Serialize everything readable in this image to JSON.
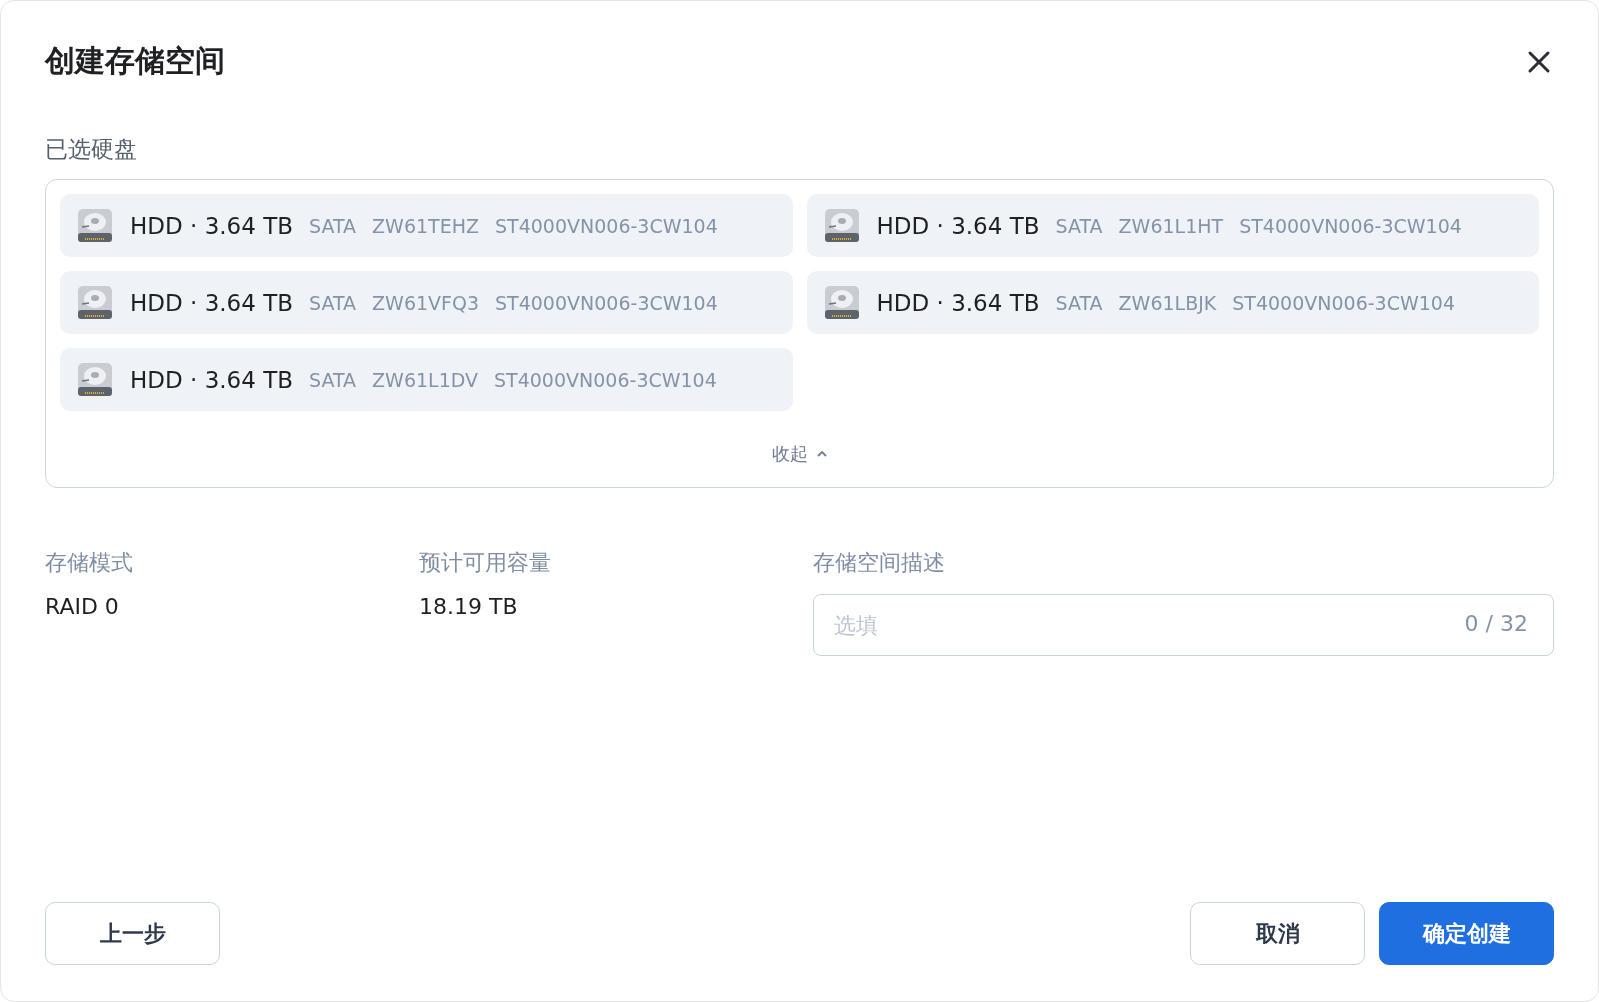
{
  "dialog": {
    "title": "创建存储空间"
  },
  "selected_disks": {
    "label": "已选硬盘",
    "collapse_link": "收起",
    "disks": [
      {
        "summary": "HDD · 3.64 TB",
        "interface": "SATA",
        "serial": "ZW61TEHZ",
        "model": "ST4000VN006-3CW104"
      },
      {
        "summary": "HDD · 3.64 TB",
        "interface": "SATA",
        "serial": "ZW61L1HT",
        "model": "ST4000VN006-3CW104"
      },
      {
        "summary": "HDD · 3.64 TB",
        "interface": "SATA",
        "serial": "ZW61VFQ3",
        "model": "ST4000VN006-3CW104"
      },
      {
        "summary": "HDD · 3.64 TB",
        "interface": "SATA",
        "serial": "ZW61LBJK",
        "model": "ST4000VN006-3CW104"
      },
      {
        "summary": "HDD · 3.64 TB",
        "interface": "SATA",
        "serial": "ZW61L1DV",
        "model": "ST4000VN006-3CW104"
      }
    ]
  },
  "storage_mode": {
    "label": "存储模式",
    "value": "RAID 0"
  },
  "capacity": {
    "label": "预计可用容量",
    "value": "18.19 TB"
  },
  "description": {
    "label": "存储空间描述",
    "placeholder": "选填",
    "counter": "0 / 32"
  },
  "buttons": {
    "back": "上一步",
    "cancel": "取消",
    "confirm": "确定创建"
  }
}
